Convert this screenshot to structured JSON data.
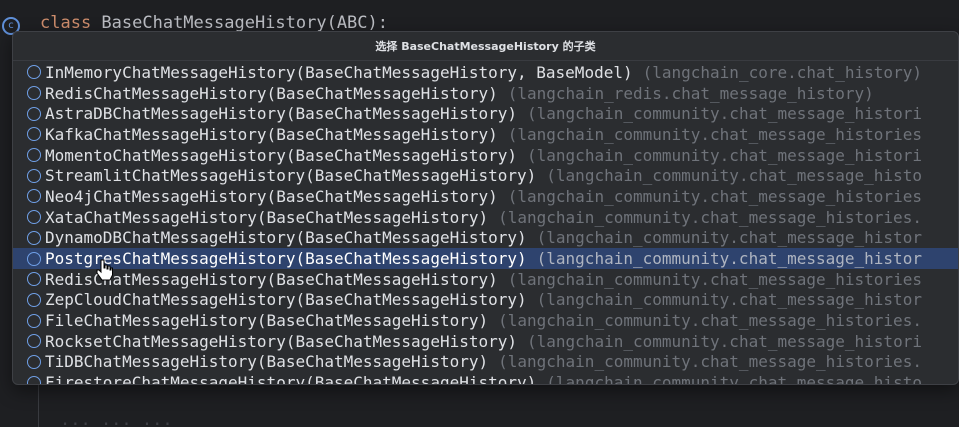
{
  "editor": {
    "gutter_icon": "c",
    "code_keyword": "class",
    "code_rest": " BaseChatMessageHistory(ABC):",
    "ghost_text": "     ...        ...          ..."
  },
  "popup": {
    "title": "选择 BaseChatMessageHistory 的子类",
    "selected_index": 9,
    "items": [
      {
        "sig": "InMemoryChatMessageHistory(BaseChatMessageHistory, BaseModel)",
        "module": "(langchain_core.chat_history)"
      },
      {
        "sig": "RedisChatMessageHistory(BaseChatMessageHistory)",
        "module": "(langchain_redis.chat_message_history)"
      },
      {
        "sig": "AstraDBChatMessageHistory(BaseChatMessageHistory)",
        "module": "(langchain_community.chat_message_histori"
      },
      {
        "sig": "KafkaChatMessageHistory(BaseChatMessageHistory)",
        "module": "(langchain_community.chat_message_histories"
      },
      {
        "sig": "MomentoChatMessageHistory(BaseChatMessageHistory)",
        "module": "(langchain_community.chat_message_histori"
      },
      {
        "sig": "StreamlitChatMessageHistory(BaseChatMessageHistory)",
        "module": "(langchain_community.chat_message_histo"
      },
      {
        "sig": "Neo4jChatMessageHistory(BaseChatMessageHistory)",
        "module": "(langchain_community.chat_message_histories"
      },
      {
        "sig": "XataChatMessageHistory(BaseChatMessageHistory)",
        "module": "(langchain_community.chat_message_histories."
      },
      {
        "sig": "DynamoDBChatMessageHistory(BaseChatMessageHistory)",
        "module": "(langchain_community.chat_message_histor"
      },
      {
        "sig": "PostgresChatMessageHistory(BaseChatMessageHistory)",
        "module": "(langchain_community.chat_message_histor"
      },
      {
        "sig": "RedisChatMessageHistory(BaseChatMessageHistory)",
        "module": "(langchain_community.chat_message_histories"
      },
      {
        "sig": "ZepCloudChatMessageHistory(BaseChatMessageHistory)",
        "module": "(langchain_community.chat_message_histor"
      },
      {
        "sig": "FileChatMessageHistory(BaseChatMessageHistory)",
        "module": "(langchain_community.chat_message_histories."
      },
      {
        "sig": "RocksetChatMessageHistory(BaseChatMessageHistory)",
        "module": "(langchain_community.chat_message_histori"
      },
      {
        "sig": "TiDBChatMessageHistory(BaseChatMessageHistory)",
        "module": "(langchain_community.chat_message_histories."
      },
      {
        "sig": "FirestoreChatMessageHistory(BaseChatMessageHistory)",
        "module": "(langchain_community.chat_message_histo"
      }
    ],
    "item_icon": "class-icon",
    "colors": {
      "background": "#2b2d30",
      "selected": "#2e436e",
      "signature": "#dfe1e5",
      "module": "#6f737a",
      "icon": "#6f9fe6"
    }
  }
}
